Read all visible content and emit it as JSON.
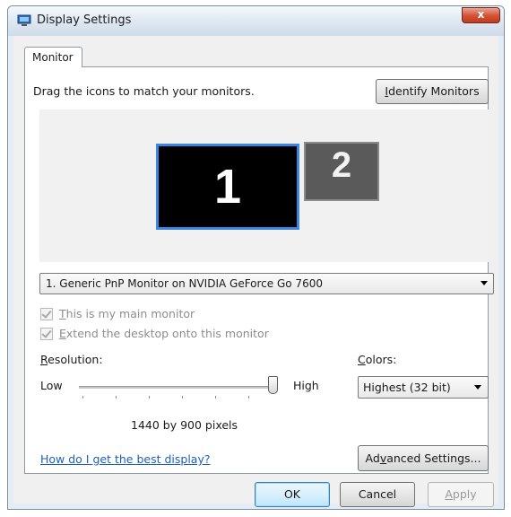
{
  "window": {
    "title": "Display Settings",
    "close_label": "x"
  },
  "tabs": [
    {
      "label": "Monitor",
      "active": true
    }
  ],
  "monitor_tab": {
    "instruction": "Drag the icons to match your monitors.",
    "identify_button": {
      "pre": "",
      "accel": "I",
      "post": "dentify Monitors"
    },
    "monitors": [
      {
        "number": "1",
        "selected": true
      },
      {
        "number": "2",
        "selected": false
      }
    ],
    "display_select": {
      "value": "1. Generic PnP Monitor on NVIDIA GeForce Go 7600"
    },
    "main_monitor_checkbox": {
      "pre": "",
      "accel": "T",
      "post": "his is my main monitor",
      "checked": true,
      "enabled": false
    },
    "extend_checkbox": {
      "pre": "",
      "accel": "E",
      "post": "xtend the desktop onto this monitor",
      "checked": true,
      "enabled": false
    },
    "resolution": {
      "label": {
        "pre": "",
        "accel": "R",
        "post": "esolution:"
      },
      "low": "Low",
      "high": "High",
      "value_text": "1440 by 900 pixels",
      "slider_position": 1.0
    },
    "colors": {
      "label": {
        "pre": "",
        "accel": "C",
        "post": "olors:"
      },
      "value": "Highest (32 bit)"
    },
    "help_link": "How do I get the best display?",
    "advanced_button": {
      "pre": "Ad",
      "accel": "v",
      "post": "anced Settings..."
    }
  },
  "footer": {
    "ok": "OK",
    "cancel": "Cancel",
    "apply": {
      "pre": "",
      "accel": "A",
      "post": "pply"
    }
  },
  "colors": {
    "accent": "#3a86e0",
    "link": "#1f5fb8",
    "close": "#c13a1f"
  }
}
